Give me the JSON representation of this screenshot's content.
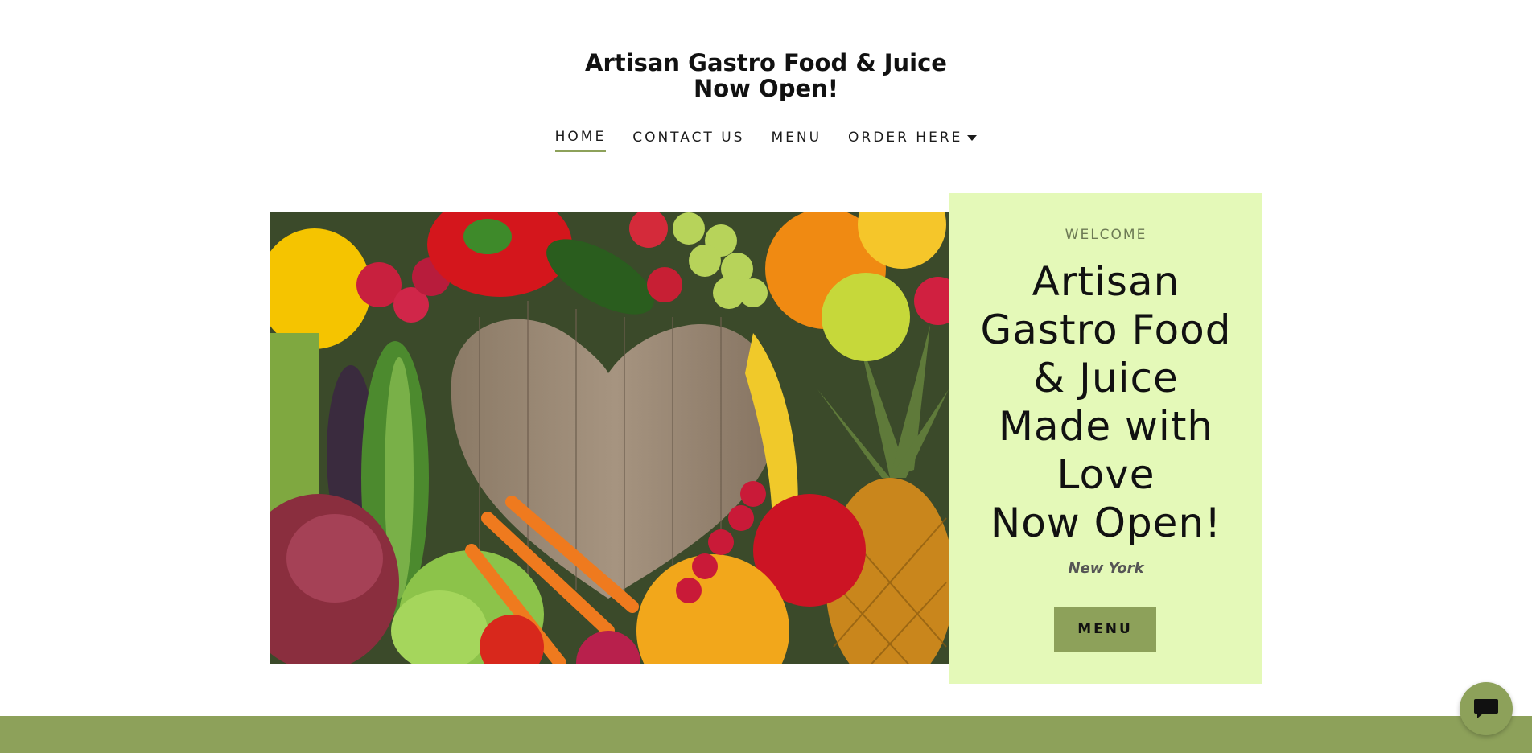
{
  "header": {
    "title_line1": "Artisan Gastro Food & Juice",
    "title_line2": "Now Open!"
  },
  "nav": {
    "items": [
      {
        "label": "HOME",
        "active": true
      },
      {
        "label": "CONTACT US"
      },
      {
        "label": "MENU"
      },
      {
        "label": "ORDER HERE",
        "has_dropdown": true
      }
    ]
  },
  "hero": {
    "image_icon": "fruit-vegetable-heart-image",
    "welcome_label": "WELCOME",
    "heading_lines": [
      "Artisan",
      "Gastro Food",
      "& Juice",
      "Made with",
      "Love",
      "Now Open!"
    ],
    "location": "New York",
    "menu_button_label": "MENU"
  },
  "chat": {
    "icon": "chat-bubble-icon"
  },
  "colors": {
    "accent": "#8da15a",
    "card_background": "#e4f9b8",
    "text": "#1b1b1b"
  }
}
